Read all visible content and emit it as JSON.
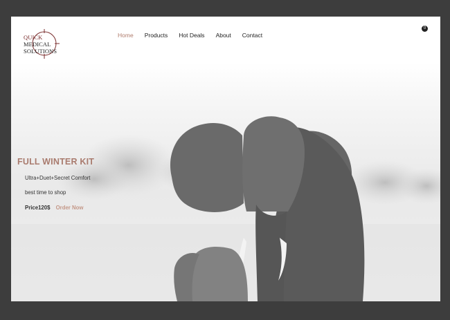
{
  "logo": {
    "lines": [
      "QUICK",
      "MEDICAL",
      "SOLUTIONS"
    ]
  },
  "nav": {
    "items": [
      {
        "label": "Home",
        "active": true
      },
      {
        "label": "Products",
        "active": false
      },
      {
        "label": "Hot Deals",
        "active": false
      },
      {
        "label": "About",
        "active": false
      },
      {
        "label": "Contact",
        "active": false
      }
    ]
  },
  "cart": {
    "count": "0"
  },
  "hero": {
    "title": "FULL WINTER KIT",
    "subtitle": "Ultra+Duet+Secret Comfort",
    "tagline": "best time to shop",
    "price": "Price120$",
    "cta": "Order Now"
  },
  "colors": {
    "accent": "#b07c6c",
    "frame": "#3d3d3d"
  }
}
